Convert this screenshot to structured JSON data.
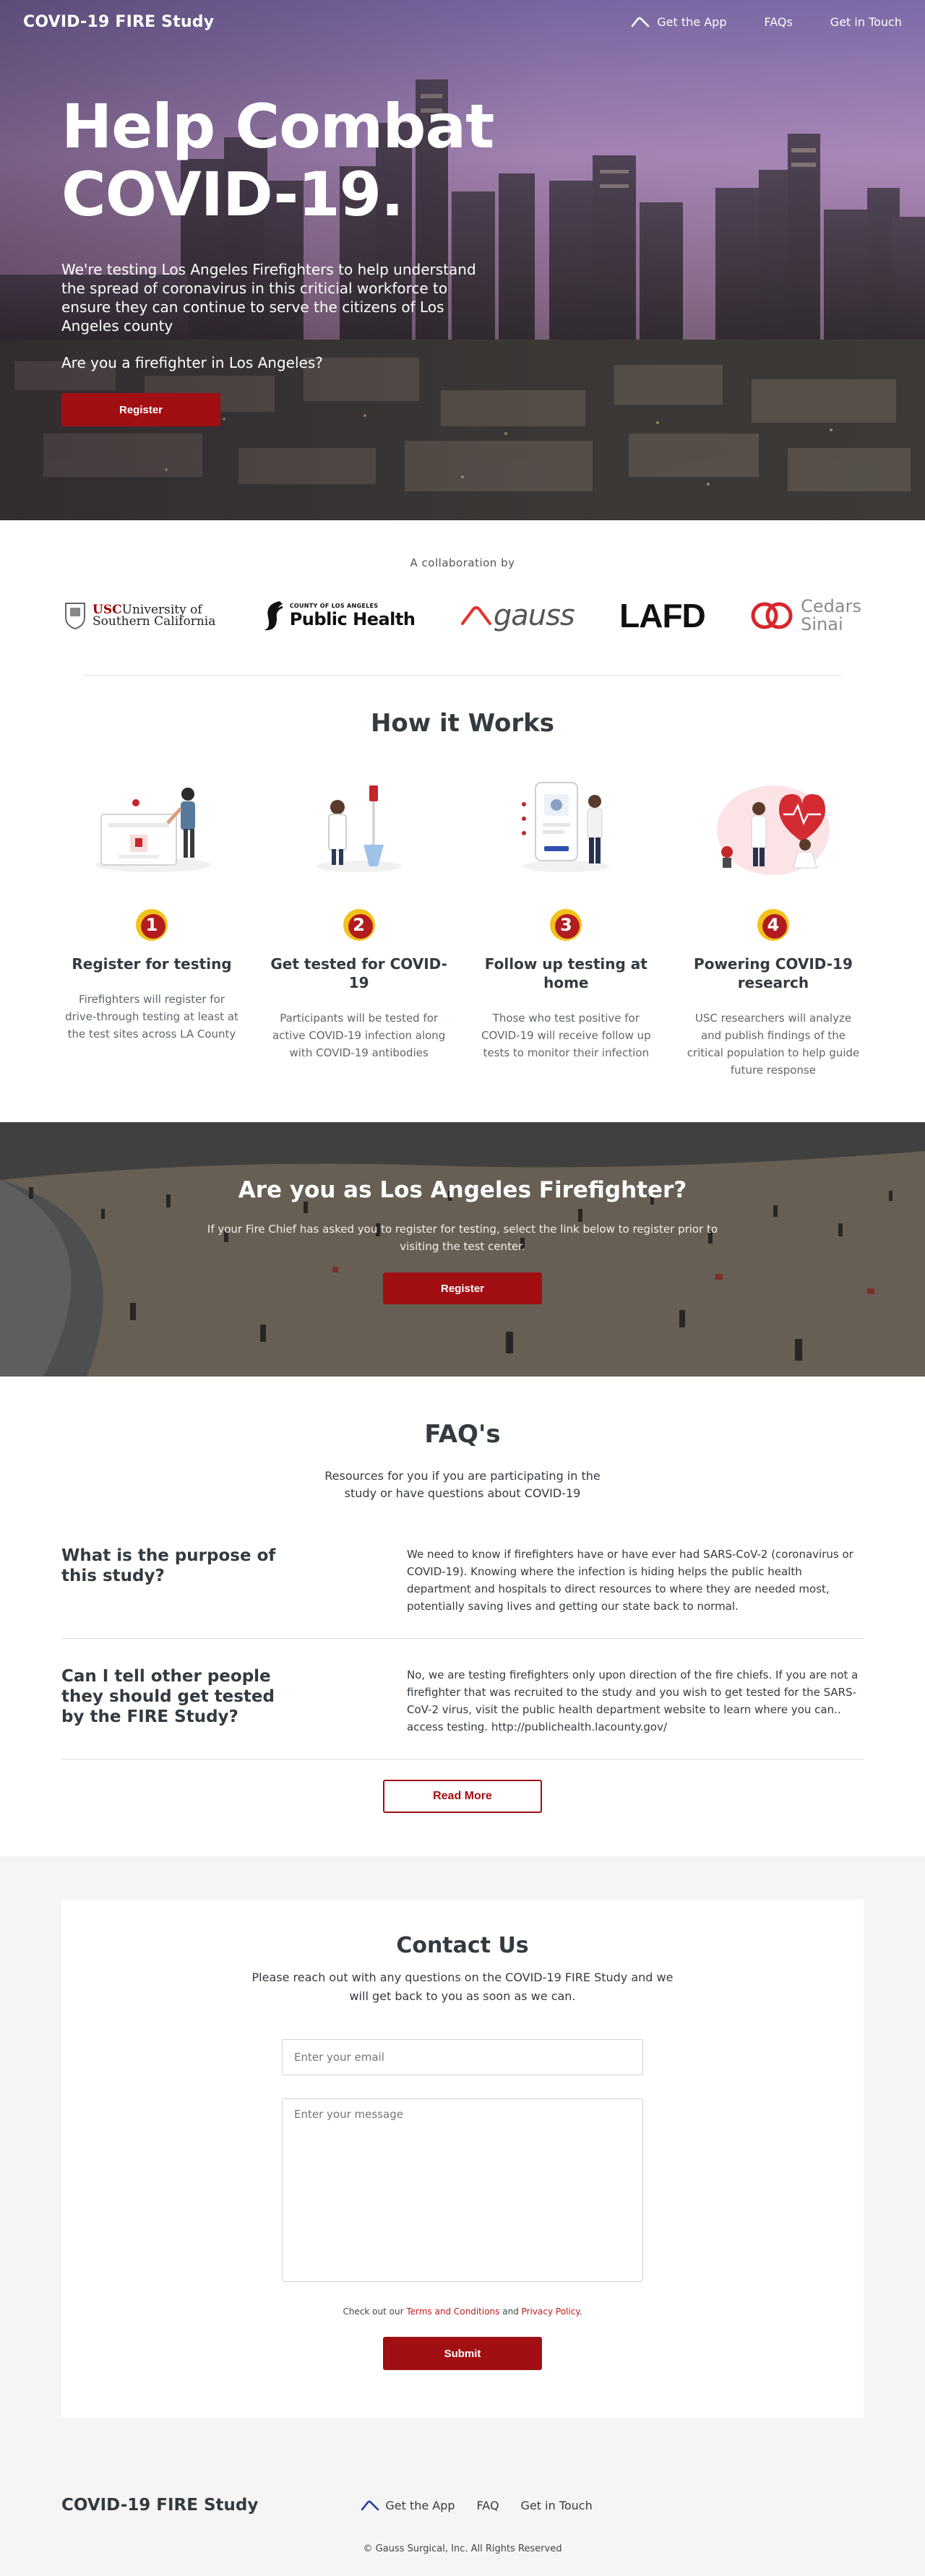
{
  "nav": {
    "brand": "COVID-19 FIRE Study",
    "links": [
      {
        "label": "Get the App",
        "icon": "gauss-chevron-icon"
      },
      {
        "label": "FAQs"
      },
      {
        "label": "Get in Touch"
      }
    ]
  },
  "hero": {
    "title_line1": "Help Combat",
    "title_line2": "COVID-19.",
    "description": "We're testing Los Angeles Firefighters to help understand the spread of coronavirus in this criticial workforce to ensure they can continue to serve the citizens of Los Angeles county",
    "question": "Are you a firefighter in Los Angeles?",
    "button": "Register"
  },
  "collaboration": {
    "label": "A collaboration by",
    "partners": [
      {
        "name": "USC University of Southern California",
        "line1": "USC",
        "line2": "University of",
        "line3": "Southern California",
        "seal": "USC-seal"
      },
      {
        "name": "County of Los Angeles Public Health",
        "top": "COUNTY OF LOS ANGELES",
        "main": "Public Health"
      },
      {
        "name": "gauss",
        "text": "gauss"
      },
      {
        "name": "LAFD",
        "text": "LAFD"
      },
      {
        "name": "Cedars Sinai",
        "line1": "Cedars",
        "line2": "Sinai"
      }
    ]
  },
  "how_it_works": {
    "title": "How it Works",
    "steps": [
      {
        "number": "1",
        "title": "Register for testing",
        "text": "Firefighters will register for drive-through testing at least at the test sites across LA County"
      },
      {
        "number": "2",
        "title": "Get tested for COVID-19",
        "text": "Participants will be tested for active COVID-19 infection along with COVID-19 antibodies"
      },
      {
        "number": "3",
        "title": "Follow up testing at home",
        "text": "Those who test positive for COVID-19 will receive follow up tests to monitor their infection"
      },
      {
        "number": "4",
        "title": "Powering COVID-19 research",
        "text": "USC researchers will analyze and publish findings of the critical population to help guide future response"
      }
    ]
  },
  "banner": {
    "title": "Are you as Los Angeles Firefighter?",
    "text": "If your Fire Chief has asked you to register for testing, select the link below to register prior to visiting the test center.",
    "button": "Register"
  },
  "faq": {
    "title": "FAQ's",
    "subtitle": "Resources for you if you are participating in the study or have questions about COVID-19",
    "items": [
      {
        "question": "What is the purpose of this study?",
        "answer": "We need to know if firefighters have or have ever had SARS-CoV-2 (coronavirus or COVID-19). Knowing where the infection is hiding helps the public health department and hospitals to direct resources to where they are needed most, potentially saving lives and getting our state back to normal."
      },
      {
        "question": "Can I tell other people they should get tested by the FIRE Study?",
        "answer": "No, we are testing firefighters only upon direction of the fire chiefs. If you are not a firefighter that was recruited to the study and you wish to get tested for the SARS-CoV-2 virus, visit the public health department website to learn where you can.. access testing. http://publichealth.lacounty.gov/"
      }
    ],
    "read_more": "Read More"
  },
  "contact": {
    "title": "Contact Us",
    "description": "Please reach out with any questions on the COVID-19 FIRE Study and we will get back to you as soon as we can.",
    "email_placeholder": "Enter your email",
    "message_placeholder": "Enter your message",
    "legal_prefix": "Check out our",
    "terms": "Terms and Conditions",
    "legal_and": "and",
    "privacy": "Privacy Policy",
    "legal_suffix": ".",
    "submit": "Submit"
  },
  "footer": {
    "brand": "COVID-19 FIRE Study",
    "links": [
      {
        "label": "Get the App",
        "icon": "gauss-chevron-icon"
      },
      {
        "label": "FAQ"
      },
      {
        "label": "Get in Touch"
      }
    ],
    "copyright": "© Gauss Surgical, Inc. All Rights Reserved"
  },
  "colors": {
    "accent_red": "#a10f12",
    "text_dark": "#333a40",
    "step_badge_yellow": "#f2c21b",
    "gauss_red": "#e5322d",
    "footer_chevron_blue": "#2438a8"
  }
}
